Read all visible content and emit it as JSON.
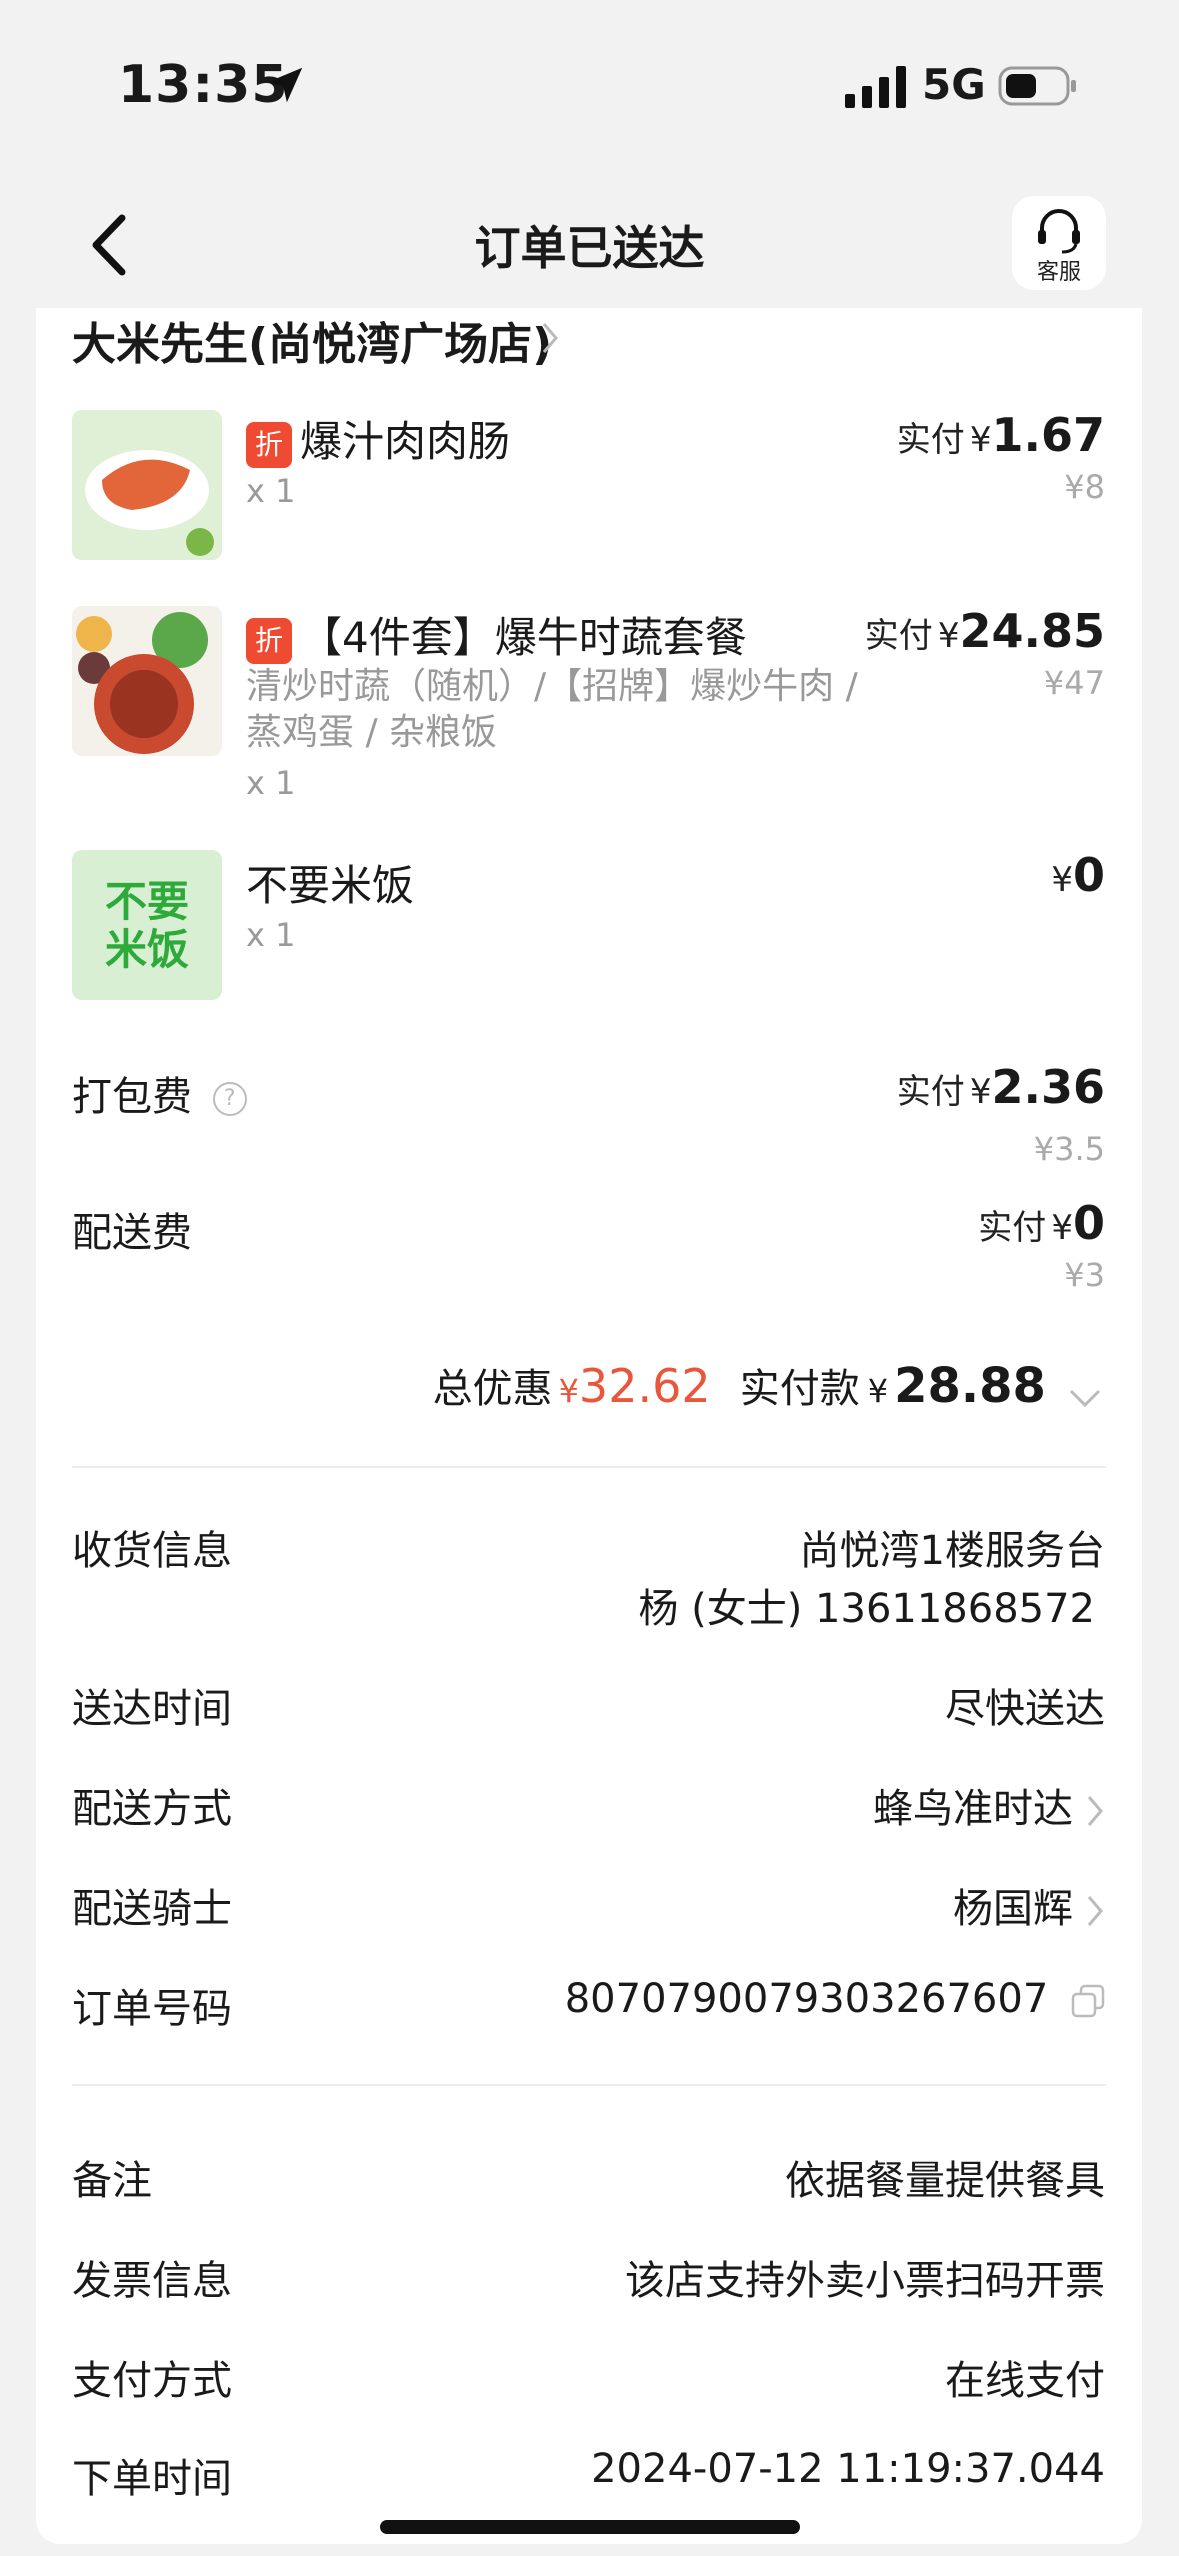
{
  "status_bar": {
    "time": "13:35",
    "network": "5G"
  },
  "header": {
    "title": "订单已送达",
    "service_label": "客服"
  },
  "shop": {
    "name": "大米先生(尚悦湾广场店)"
  },
  "items": [
    {
      "discount_badge": "折",
      "name": "爆汁肉肉肠",
      "spec_line1": "",
      "spec_line2": "",
      "qty": "x 1",
      "paid_label": "实付",
      "currency": "¥",
      "paid_amount": "1.67",
      "original_price": "¥8"
    },
    {
      "discount_badge": "折",
      "name": "【4件套】爆牛时蔬套餐",
      "spec_line1": "清炒时蔬（随机）/【招牌】爆炒牛肉 /",
      "spec_line2": "蒸鸡蛋 / 杂粮饭",
      "qty": "x 1",
      "paid_label": "实付",
      "currency": "¥",
      "paid_amount": "24.85",
      "original_price": "¥47"
    },
    {
      "discount_badge": "",
      "name": "不要米饭",
      "thumb_text_1": "不要",
      "thumb_text_2": "米饭",
      "qty": "x 1",
      "currency": "¥",
      "paid_amount": "0"
    }
  ],
  "fees": {
    "packing": {
      "label": "打包费",
      "info_icon": "?",
      "paid_label": "实付",
      "currency": "¥",
      "amount": "2.36",
      "original": "¥3.5"
    },
    "delivery": {
      "label": "配送费",
      "paid_label": "实付",
      "currency": "¥",
      "amount": "0",
      "original": "¥3"
    }
  },
  "summary": {
    "discount_label": "总优惠",
    "discount_currency": "¥",
    "discount_amount": "32.62",
    "paid_label": "实付款",
    "paid_currency": "¥",
    "paid_amount": "28.88"
  },
  "delivery_info": {
    "receiver_label": "收货信息",
    "receiver_address": "尚悦湾1楼服务台",
    "receiver_contact": "杨 (女士) 13611868572",
    "time_label": "送达时间",
    "time_value": "尽快送达",
    "method_label": "配送方式",
    "method_value": "蜂鸟准时达",
    "rider_label": "配送骑士",
    "rider_value": "杨国辉",
    "order_no_label": "订单号码",
    "order_no_value": "8070790079303267607"
  },
  "extra_info": {
    "note_label": "备注",
    "note_value": "依据餐量提供餐具",
    "invoice_label": "发票信息",
    "invoice_value": "该店支持外卖小票扫码开票",
    "payment_label": "支付方式",
    "payment_value": "在线支付",
    "order_time_label": "下单时间",
    "order_time_value": "2024-07-12 11:19:37.044"
  },
  "colors": {
    "accent_red": "#ef4b33",
    "discount_text": "#e8573c",
    "thumb_green": "#2eaa3a"
  },
  "icons": [
    "location-arrow-icon",
    "signal-icon",
    "battery-icon",
    "back-arrow-icon",
    "headset-icon",
    "chevron-right-icon",
    "info-icon",
    "chevron-down-icon",
    "copy-icon"
  ]
}
